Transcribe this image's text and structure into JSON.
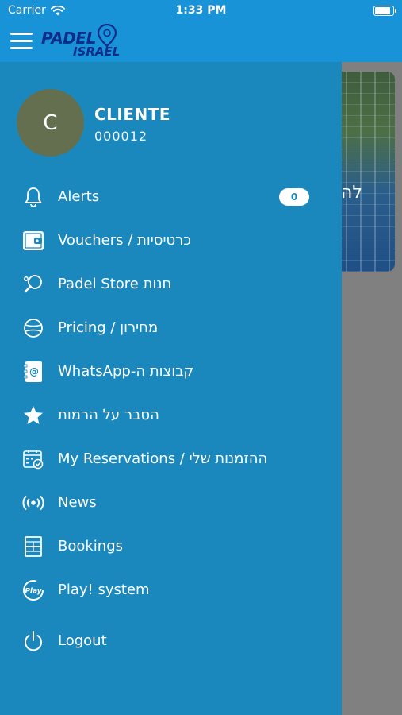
{
  "status_bar": {
    "carrier": "Carrier",
    "time": "1:33 PM",
    "battery_level": 0.9
  },
  "header": {
    "logo_line1": "PADEL",
    "logo_line2": "ISRAEL"
  },
  "user": {
    "initial": "C",
    "name": "CLIENTE",
    "code": "000012"
  },
  "background_card": {
    "text": "לה"
  },
  "menu": [
    {
      "label": "Alerts",
      "icon": "bell-icon",
      "badge": "0"
    },
    {
      "label": "Vouchers / כרטיסיות",
      "icon": "wallet-icon"
    },
    {
      "label": "Padel Store חנות",
      "icon": "racket-icon"
    },
    {
      "label": "Pricing / מחירון",
      "icon": "ball-icon"
    },
    {
      "label": "WhatsApp-קבוצות ה",
      "icon": "contacts-book-icon"
    },
    {
      "label": "הסבר על הרמות",
      "icon": "star-icon"
    },
    {
      "label": "My Reservations / ההזמנות שלי",
      "icon": "calendar-icon"
    },
    {
      "label": "News",
      "icon": "broadcast-icon"
    },
    {
      "label": "Bookings",
      "icon": "court-icon"
    },
    {
      "label": "Play! system",
      "icon": "play-system-icon"
    },
    {
      "label": "Logout",
      "icon": "power-icon"
    }
  ],
  "colors": {
    "header": "#1893d8",
    "drawer": "#1b88bd",
    "avatar": "#636f4e",
    "overlay": "#808080"
  }
}
